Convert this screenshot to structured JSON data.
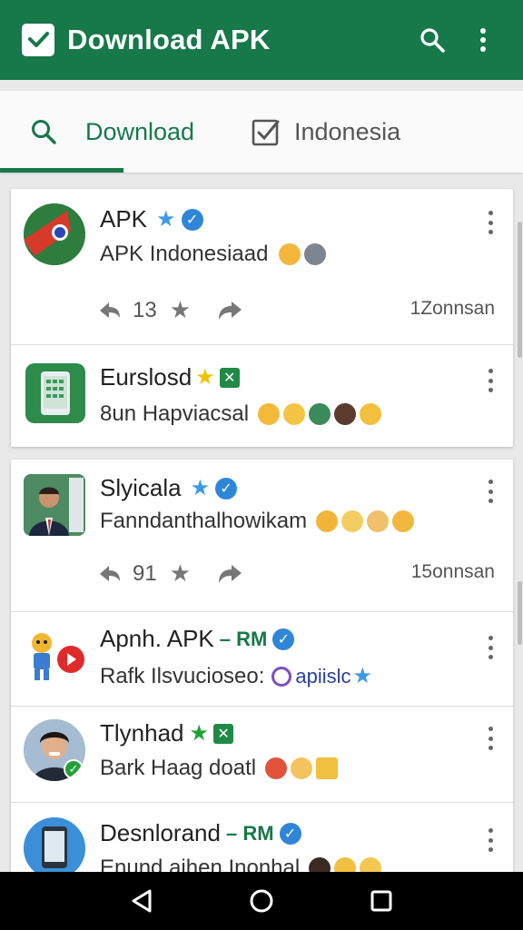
{
  "app": {
    "title": "Download APK"
  },
  "tabs": [
    {
      "label": "Download",
      "active": true
    },
    {
      "label": "Indonesia",
      "active": false
    }
  ],
  "items": [
    {
      "title": "APK",
      "subtitle": "APK Indonesiaad",
      "likes": "13",
      "time": "1Zonnsan"
    },
    {
      "title": "Eurslosd",
      "subtitle": "8un Hapviacsal"
    },
    {
      "title": "Slyicala",
      "subtitle": "Fanndanthalhowikam",
      "likes": "91",
      "time": "15onnsan"
    },
    {
      "title": "Apnh. APK",
      "tag": "– RM",
      "subtitle": "Rafk Ilsvucioseo:",
      "subtitle_link": "apiislc"
    },
    {
      "title": "Tlynhad",
      "subtitle": "Bark Haag doatl"
    },
    {
      "title": "Desnlorand",
      "tag": "– RM",
      "subtitle": "Enund aihen Inonhal"
    }
  ],
  "colors": {
    "primary": "#17784a",
    "verified": "#2f86d8",
    "star_blue": "#3d9ae8",
    "star_yellow": "#f2c200"
  }
}
